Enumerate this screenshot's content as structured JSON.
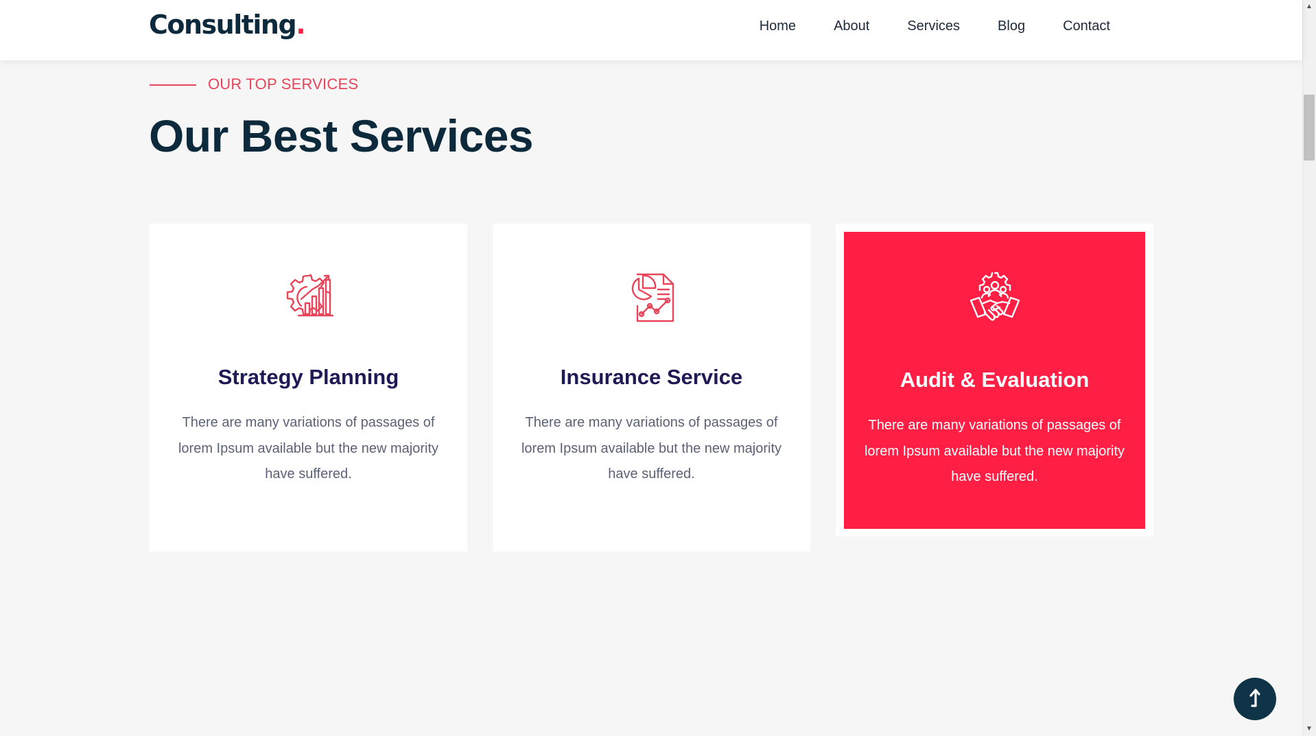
{
  "header": {
    "logo_text": "Consulting",
    "logo_dot": ".",
    "nav": [
      "Home",
      "About",
      "Services",
      "Blog",
      "Contact"
    ]
  },
  "section": {
    "eyebrow": "OUR TOP SERVICES",
    "title": "Our Best Services"
  },
  "cards": [
    {
      "icon": "gear-growth-chart-icon",
      "title": "Strategy Planning",
      "text": "There are many variations of passages of lorem Ipsum available but the new majority have suffered.",
      "active": false
    },
    {
      "icon": "report-pie-chart-icon",
      "title": "Insurance Service",
      "text": "There are many variations of passages of lorem Ipsum available but the new majority have suffered.",
      "active": false
    },
    {
      "icon": "team-handshake-icon",
      "title": "Audit & Evaluation",
      "text": "There are many variations of passages of lorem Ipsum available but the new majority have suffered.",
      "active": true
    }
  ],
  "back_to_top": {
    "icon": "arrow-up-icon"
  },
  "colors": {
    "accent": "#ff1f45",
    "heading": "#0d2a3c",
    "card_title": "#1d1a55",
    "body_text": "#5c6275",
    "background": "#f6f6f6",
    "back_to_top": "#0f3347"
  }
}
